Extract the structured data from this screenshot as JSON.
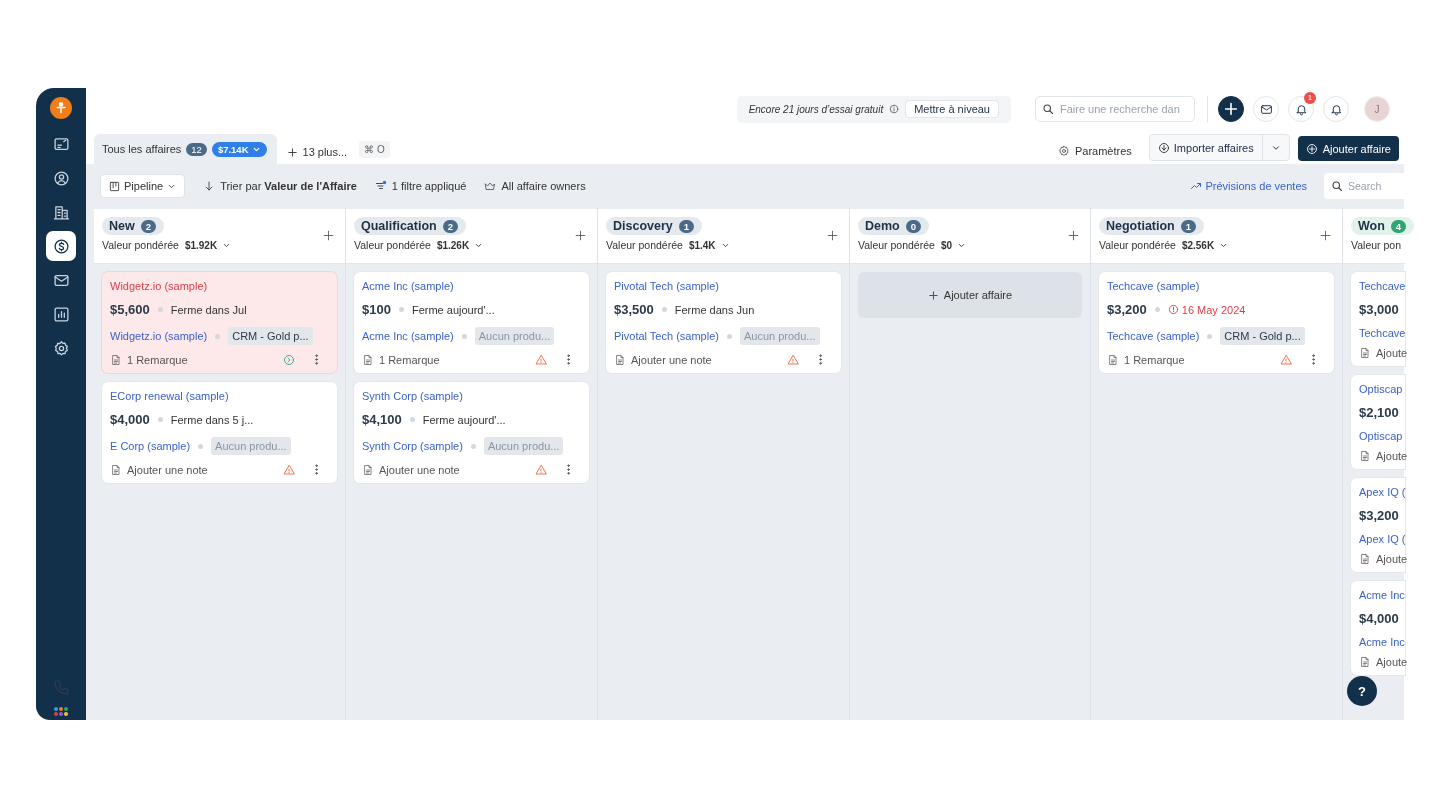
{
  "sidebar": {
    "items": [
      {
        "selected": false
      },
      {
        "selected": false
      },
      {
        "selected": false
      },
      {
        "selected": true
      },
      {
        "selected": false
      },
      {
        "selected": false
      },
      {
        "selected": false
      }
    ]
  },
  "topbar": {
    "trial_text": "Encore 21 jours d’essai gratuit",
    "upgrade_button": "Mettre à niveau",
    "search": {
      "placeholder": "Faire une recherche dan"
    },
    "notification_count": "1",
    "avatar": "J"
  },
  "tabs": [
    {
      "label": "Tous les affaires",
      "count": "12",
      "value": "$7.14K",
      "selected": true
    }
  ],
  "more_views": {
    "label": "13 plus...",
    "shortcut": "⌘ O"
  },
  "actions": {
    "settings": "Paramètres",
    "import": "Importer affaires",
    "add": "Ajouter affaire"
  },
  "toolbar": {
    "view": "Pipeline",
    "sort_prefix": "Trier par",
    "sort_field": "Valeur de l'Affaire",
    "filter": "1 filtre appliqué",
    "owners": "All affaire owners",
    "forecast": "Prévisions de ventes",
    "search": {
      "placeholder": "Search"
    }
  },
  "columns": [
    {
      "name": "New",
      "count": "2",
      "color": "#4b6a88",
      "weighted_label": "Valeur pondérée",
      "weighted_value": "$1.92K",
      "cards": [
        {
          "title": "Widgetz.io (sample)",
          "alert": true,
          "amount": "$5,600",
          "close": "Ferme dans Jul",
          "overdue": false,
          "company": "Widgetz.io (sample)",
          "product": "CRM - Gold p...",
          "muted": false,
          "note": "1 Remarque",
          "warning": false
        },
        {
          "title": "ECorp renewal (sample)",
          "alert": false,
          "amount": "$4,000",
          "close": "Ferme dans 5 j...",
          "overdue": false,
          "company": "E Corp (sample)",
          "product": "Aucun produ...",
          "muted": true,
          "note": "Ajouter une note",
          "warning": true
        }
      ]
    },
    {
      "name": "Qualification",
      "count": "2",
      "color": "#4b6a88",
      "weighted_label": "Valeur pondérée",
      "weighted_value": "$1.26K",
      "cards": [
        {
          "title": "Acme Inc (sample)",
          "alert": false,
          "amount": "$100",
          "close": "Ferme aujourd'...",
          "overdue": false,
          "company": "Acme Inc (sample)",
          "product": "Aucun produ...",
          "muted": true,
          "note": "1 Remarque",
          "warning": true
        },
        {
          "title": "Synth Corp (sample)",
          "alert": false,
          "amount": "$4,100",
          "close": "Ferme aujourd'...",
          "overdue": false,
          "company": "Synth Corp (sample)",
          "product": "Aucun produ...",
          "muted": true,
          "note": "Ajouter une note",
          "warning": true
        }
      ]
    },
    {
      "name": "Discovery",
      "count": "1",
      "color": "#4b6a88",
      "weighted_label": "Valeur pondérée",
      "weighted_value": "$1.4K",
      "cards": [
        {
          "title": "Pivotal Tech (sample)",
          "alert": false,
          "amount": "$3,500",
          "close": "Ferme dans Jun",
          "overdue": false,
          "company": "Pivotal Tech (sample)",
          "product": "Aucun produ...",
          "muted": true,
          "note": "Ajouter une note",
          "warning": true
        }
      ]
    },
    {
      "name": "Demo",
      "count": "0",
      "color": "#4b6a88",
      "weighted_label": "Valeur pondérée",
      "weighted_value": "$0",
      "empty_action": "Ajouter affaire"
    },
    {
      "name": "Negotiation",
      "count": "1",
      "color": "#4b6a88",
      "weighted_label": "Valeur pondérée",
      "weighted_value": "$2.56K",
      "cards": [
        {
          "title": "Techcave (sample)",
          "alert": false,
          "amount": "$3,200",
          "close": "16 May 2024",
          "overdue": true,
          "company": "Techcave (sample)",
          "product": "CRM - Gold p...",
          "muted": false,
          "note": "1 Remarque",
          "warning": true
        }
      ]
    },
    {
      "name": "Won",
      "count": "4",
      "color": "#2fa572",
      "weighted_label": "Valeur pon",
      "cards": [
        {
          "title": "Techcave",
          "alert": false,
          "amount": "$3,000",
          "company": "Techcave",
          "note": "Ajoute"
        },
        {
          "title": "Optiscap",
          "alert": false,
          "amount": "$2,100",
          "company": "Optiscap",
          "note": "Ajoute"
        },
        {
          "title": "Apex IQ (",
          "alert": false,
          "amount": "$3,200",
          "company": "Apex IQ (",
          "note": "Ajoute"
        },
        {
          "title": "Acme Inc",
          "alert": false,
          "amount": "$4,000",
          "company": "Acme Inc",
          "note": "Ajoute"
        }
      ]
    }
  ],
  "help_button": "?"
}
